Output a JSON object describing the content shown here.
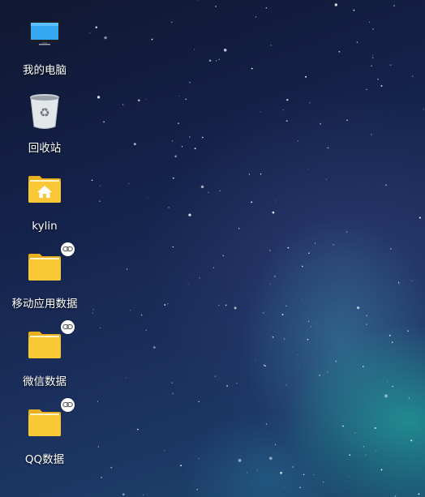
{
  "desktop": {
    "icons": [
      {
        "label": "我的电脑",
        "icon": "computer-icon"
      },
      {
        "label": "回收站",
        "icon": "trash-icon"
      },
      {
        "label": "kylin",
        "icon": "home-folder-icon"
      },
      {
        "label": "移动应用数据",
        "icon": "folder-link-icon"
      },
      {
        "label": "微信数据",
        "icon": "folder-link-icon"
      },
      {
        "label": "QQ数据",
        "icon": "folder-link-icon"
      }
    ]
  },
  "colors": {
    "folder": "#f7c935",
    "folder_back": "#e9b122",
    "monitor_screen": "#33a5ef"
  }
}
